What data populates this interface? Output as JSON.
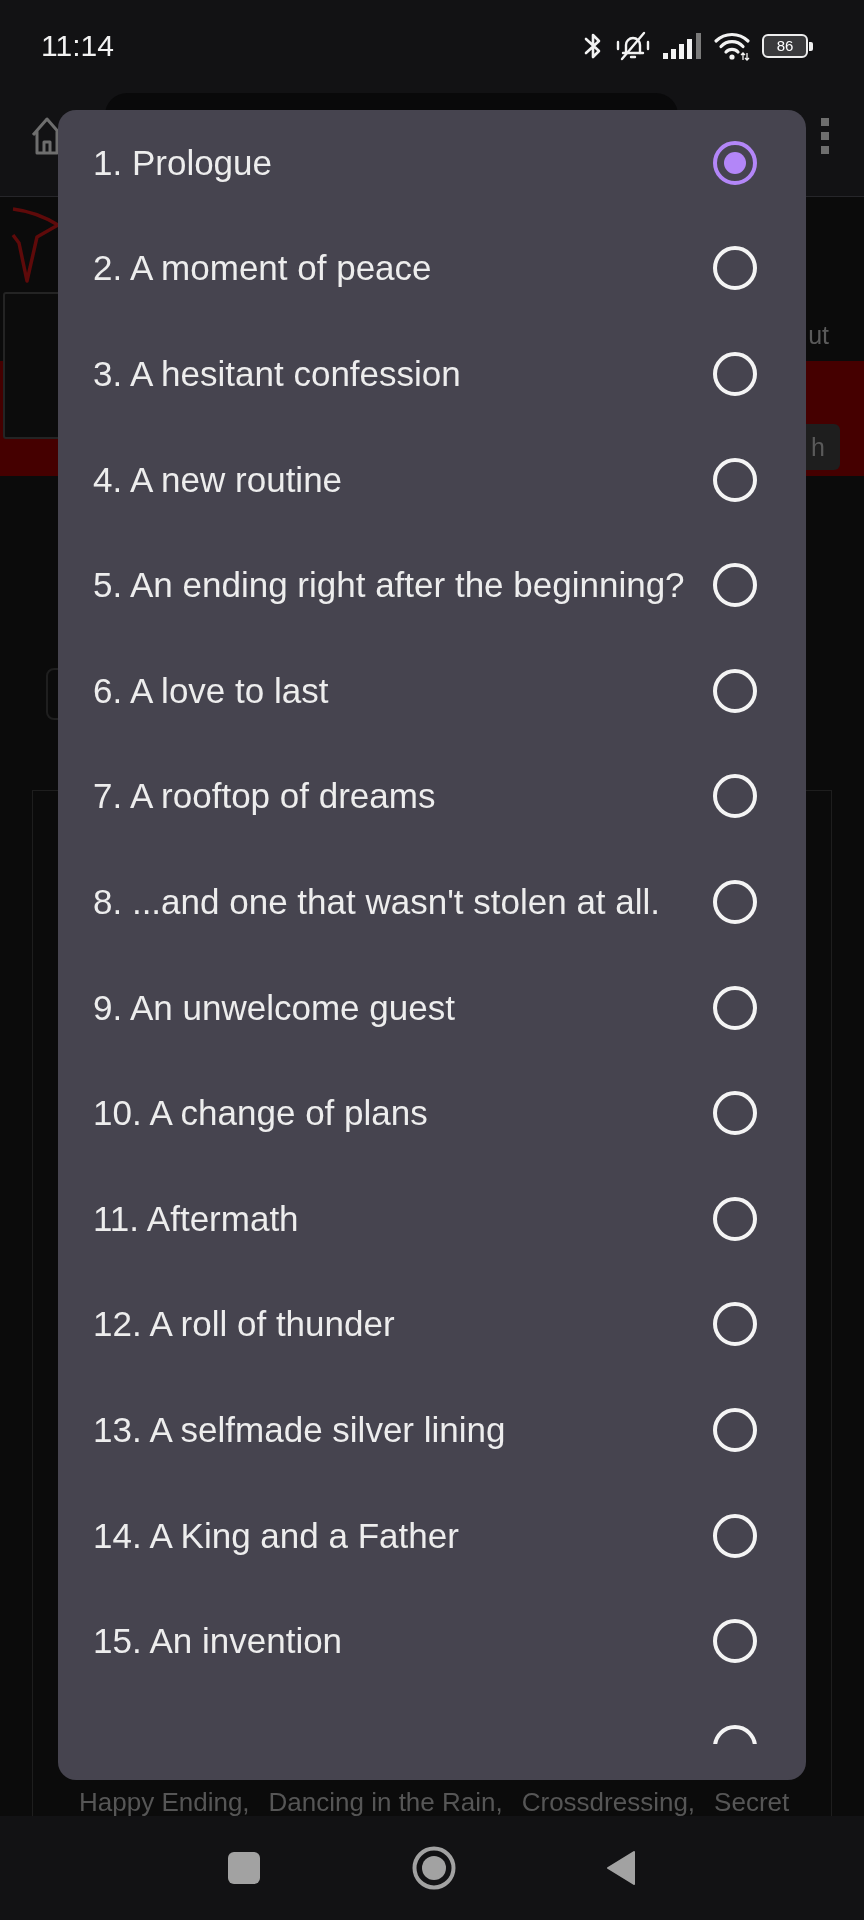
{
  "status_bar": {
    "time": "11:14",
    "battery": "86"
  },
  "background_page": {
    "edge_text": "ut",
    "edge_button": "h",
    "tags": [
      "Happy Ending,",
      "Dancing in the Rain,",
      "Crossdressing,",
      "Secret"
    ]
  },
  "chapter_dialog": {
    "chapters": [
      {
        "label": "1. Prologue",
        "selected": true
      },
      {
        "label": "2. A moment of peace",
        "selected": false
      },
      {
        "label": "3. A hesitant confession",
        "selected": false
      },
      {
        "label": "4. A new routine",
        "selected": false
      },
      {
        "label": "5. An ending right after the beginning?",
        "selected": false
      },
      {
        "label": "6. A love to last",
        "selected": false
      },
      {
        "label": "7. A rooftop of dreams",
        "selected": false
      },
      {
        "label": "8. ...and one that wasn't stolen at all.",
        "selected": false
      },
      {
        "label": "9. An unwelcome guest",
        "selected": false
      },
      {
        "label": "10. A change of plans",
        "selected": false
      },
      {
        "label": "11. Aftermath",
        "selected": false
      },
      {
        "label": "12. A roll of thunder",
        "selected": false
      },
      {
        "label": "13. A selfmade silver lining",
        "selected": false
      },
      {
        "label": "14. A King and a Father",
        "selected": false
      },
      {
        "label": "15. An invention",
        "selected": false
      },
      {
        "selected": false
      }
    ]
  }
}
